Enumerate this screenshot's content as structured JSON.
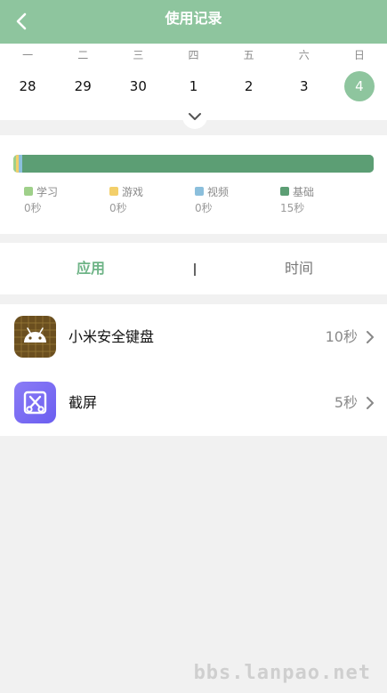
{
  "header": {
    "title": "使用记录"
  },
  "calendar": {
    "weekdays": [
      "一",
      "二",
      "三",
      "四",
      "五",
      "六",
      "日"
    ],
    "dates": [
      "28",
      "29",
      "30",
      "1",
      "2",
      "3",
      "4"
    ],
    "selected_index": 6
  },
  "summary": {
    "bar_segments": [
      {
        "category": "学习",
        "fraction": 0.008,
        "color": "#9fd08a"
      },
      {
        "category": "游戏",
        "fraction": 0.008,
        "color": "#f3cf6a"
      },
      {
        "category": "视频",
        "fraction": 0.008,
        "color": "#8bbfdc"
      },
      {
        "category": "基础",
        "fraction": 0.976,
        "color": "#5c9e74"
      }
    ],
    "legend": [
      {
        "label": "学习",
        "value": "0秒",
        "color": "#9fd08a"
      },
      {
        "label": "游戏",
        "value": "0秒",
        "color": "#f3cf6a"
      },
      {
        "label": "视频",
        "value": "0秒",
        "color": "#8bbfdc"
      },
      {
        "label": "基础",
        "value": "15秒",
        "color": "#5c9e74"
      }
    ]
  },
  "tabs": {
    "apps_label": "应用",
    "time_label": "时间"
  },
  "apps": [
    {
      "name": "小米安全键盘",
      "time": "10秒",
      "icon": "android-icon"
    },
    {
      "name": "截屏",
      "time": "5秒",
      "icon": "screenshot-icon"
    }
  ],
  "watermark": "bbs.lanpao.net"
}
